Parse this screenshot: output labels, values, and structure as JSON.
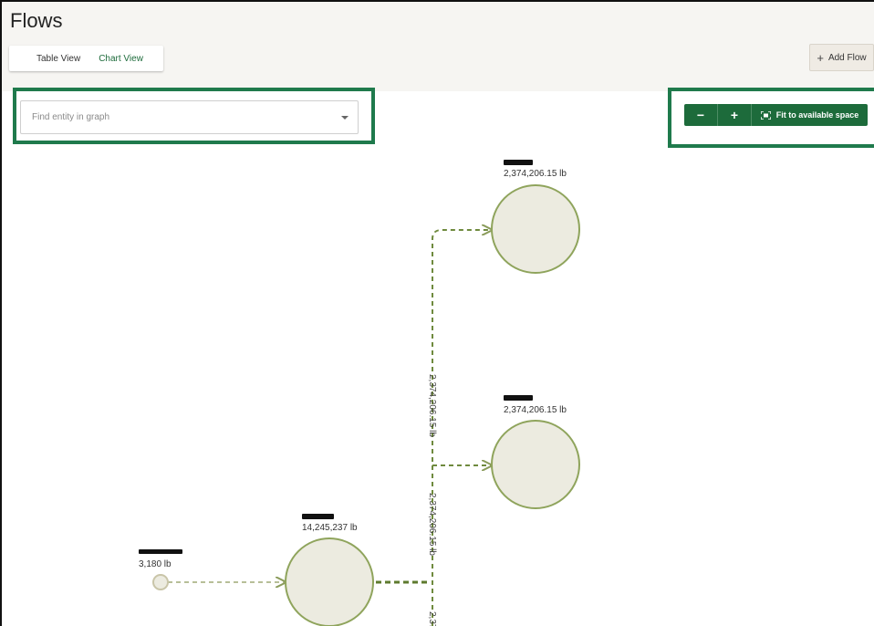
{
  "app": {
    "title": "Flows"
  },
  "tabs": [
    {
      "label": "Table View",
      "active": false
    },
    {
      "label": "Chart View",
      "active": true
    }
  ],
  "toolbar": {
    "add_flow_label": "Add Flow"
  },
  "search": {
    "placeholder": "Find entity in graph",
    "value": ""
  },
  "zoom": {
    "minus_label": "−",
    "plus_label": "+",
    "fit_label": "Fit to available space"
  },
  "graph": {
    "nodes": [
      {
        "id": "n_top",
        "value": "2,374,206.15 lb"
      },
      {
        "id": "n_mid",
        "value": "2,374,206.15 lb"
      },
      {
        "id": "n_main",
        "value": "14,245,237 lb"
      },
      {
        "id": "n_small",
        "value": "3,180 lb"
      }
    ],
    "edges": [
      {
        "label": "2,374,206.15 lb"
      },
      {
        "label": "2,374,206.15 lb"
      },
      {
        "label": "2,37"
      }
    ]
  },
  "colors": {
    "brand_green": "#1d6b3b",
    "node_fill": "#ecebe0",
    "node_stroke": "#8fa45c",
    "edge": "#6f8a3e"
  }
}
